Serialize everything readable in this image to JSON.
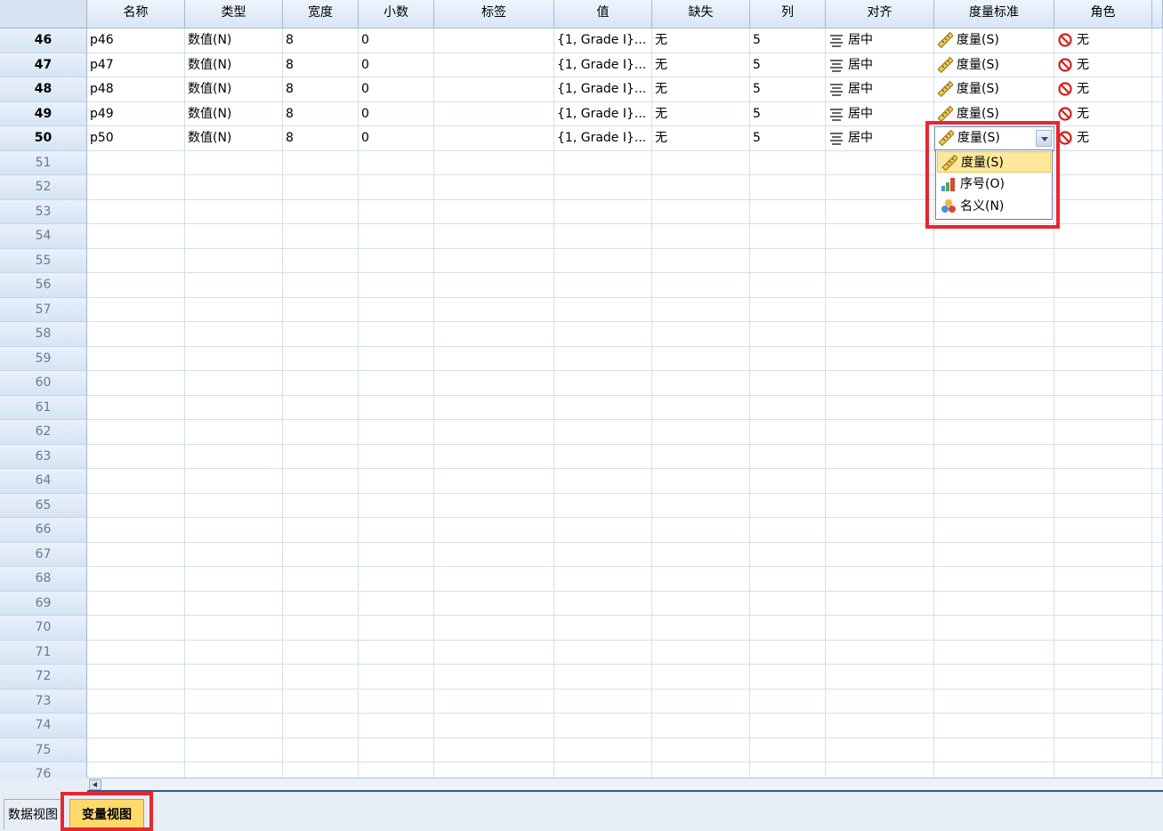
{
  "columns": [
    "名称",
    "类型",
    "宽度",
    "小数",
    "标签",
    "值",
    "缺失",
    "列",
    "对齐",
    "度量标准",
    "角色"
  ],
  "rows": [
    {
      "num": "46",
      "name": "p46",
      "type": "数值(N)",
      "width": "8",
      "decimals": "0",
      "label": "",
      "values": "{1, Grade I}...",
      "missing": "无",
      "columns": "5",
      "align": "居中",
      "measure": "度量(S)",
      "role": "无"
    },
    {
      "num": "47",
      "name": "p47",
      "type": "数值(N)",
      "width": "8",
      "decimals": "0",
      "label": "",
      "values": "{1, Grade I}...",
      "missing": "无",
      "columns": "5",
      "align": "居中",
      "measure": "度量(S)",
      "role": "无"
    },
    {
      "num": "48",
      "name": "p48",
      "type": "数值(N)",
      "width": "8",
      "decimals": "0",
      "label": "",
      "values": "{1, Grade I}...",
      "missing": "无",
      "columns": "5",
      "align": "居中",
      "measure": "度量(S)",
      "role": "无"
    },
    {
      "num": "49",
      "name": "p49",
      "type": "数值(N)",
      "width": "8",
      "decimals": "0",
      "label": "",
      "values": "{1, Grade I}...",
      "missing": "无",
      "columns": "5",
      "align": "居中",
      "measure": "度量(S)",
      "role": "无"
    },
    {
      "num": "50",
      "name": "p50",
      "type": "数值(N)",
      "width": "8",
      "decimals": "0",
      "label": "",
      "values": "{1, Grade I}...",
      "missing": "无",
      "columns": "5",
      "align": "居中",
      "measure": "度量(S)",
      "role": "无"
    }
  ],
  "empty_rows": [
    "51",
    "52",
    "53",
    "54",
    "55",
    "56",
    "57",
    "58",
    "59",
    "60",
    "61",
    "62",
    "63",
    "64",
    "65",
    "66",
    "67",
    "68",
    "69",
    "70",
    "71",
    "72",
    "73",
    "74",
    "75",
    "76"
  ],
  "dropdown": {
    "current": "度量(S)",
    "options": [
      {
        "label": "度量(S)",
        "icon": "ruler-icon",
        "selected": true
      },
      {
        "label": "序号(O)",
        "icon": "ordinal-bars-icon",
        "selected": false
      },
      {
        "label": "名义(N)",
        "icon": "nominal-circles-icon",
        "selected": false
      }
    ]
  },
  "tabs": [
    {
      "label": "数据视图",
      "active": false
    },
    {
      "label": "变量视图",
      "active": true
    }
  ],
  "icons": {
    "measure": "ruler-icon",
    "align": "align-center-icon",
    "role": "no-role-icon"
  },
  "colors": {
    "highlight_box": "#e8262f",
    "active_tab": "#ffd96a",
    "selected_option": "#fde79a"
  }
}
